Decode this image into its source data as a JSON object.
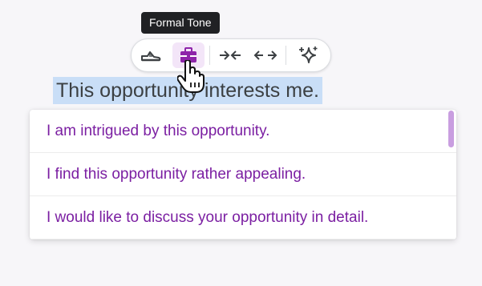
{
  "tooltip": {
    "text": "Formal Tone"
  },
  "toolbar": {
    "buttons": [
      {
        "icon": "shoe-icon",
        "label": "Casual Tone"
      },
      {
        "icon": "briefcase-icon",
        "label": "Formal Tone",
        "active": true
      },
      {
        "icon": "shorten-icon",
        "label": "Shorten"
      },
      {
        "icon": "elaborate-icon",
        "label": "Elaborate"
      },
      {
        "icon": "sparkle-icon",
        "label": "Rephrase"
      }
    ],
    "accent_color": "#8e24aa"
  },
  "selected_text": "This opportunity interests me.",
  "suggestions": [
    "I am intrigued by this opportunity.",
    "I find this opportunity rather appealing.",
    "I would like to discuss your opportunity in detail."
  ],
  "colors": {
    "suggestion_text": "#7b1fa2",
    "selection_highlight": "#c9def7",
    "scrollbar": "#c99ee0"
  }
}
